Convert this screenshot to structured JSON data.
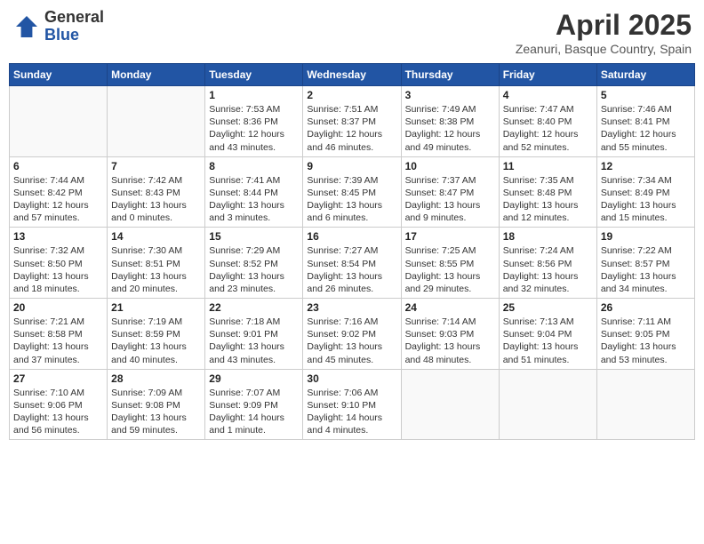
{
  "header": {
    "logo_general": "General",
    "logo_blue": "Blue",
    "month_title": "April 2025",
    "location": "Zeanuri, Basque Country, Spain"
  },
  "days_of_week": [
    "Sunday",
    "Monday",
    "Tuesday",
    "Wednesday",
    "Thursday",
    "Friday",
    "Saturday"
  ],
  "weeks": [
    [
      {
        "day": "",
        "info": ""
      },
      {
        "day": "",
        "info": ""
      },
      {
        "day": "1",
        "info": "Sunrise: 7:53 AM\nSunset: 8:36 PM\nDaylight: 12 hours and 43 minutes."
      },
      {
        "day": "2",
        "info": "Sunrise: 7:51 AM\nSunset: 8:37 PM\nDaylight: 12 hours and 46 minutes."
      },
      {
        "day": "3",
        "info": "Sunrise: 7:49 AM\nSunset: 8:38 PM\nDaylight: 12 hours and 49 minutes."
      },
      {
        "day": "4",
        "info": "Sunrise: 7:47 AM\nSunset: 8:40 PM\nDaylight: 12 hours and 52 minutes."
      },
      {
        "day": "5",
        "info": "Sunrise: 7:46 AM\nSunset: 8:41 PM\nDaylight: 12 hours and 55 minutes."
      }
    ],
    [
      {
        "day": "6",
        "info": "Sunrise: 7:44 AM\nSunset: 8:42 PM\nDaylight: 12 hours and 57 minutes."
      },
      {
        "day": "7",
        "info": "Sunrise: 7:42 AM\nSunset: 8:43 PM\nDaylight: 13 hours and 0 minutes."
      },
      {
        "day": "8",
        "info": "Sunrise: 7:41 AM\nSunset: 8:44 PM\nDaylight: 13 hours and 3 minutes."
      },
      {
        "day": "9",
        "info": "Sunrise: 7:39 AM\nSunset: 8:45 PM\nDaylight: 13 hours and 6 minutes."
      },
      {
        "day": "10",
        "info": "Sunrise: 7:37 AM\nSunset: 8:47 PM\nDaylight: 13 hours and 9 minutes."
      },
      {
        "day": "11",
        "info": "Sunrise: 7:35 AM\nSunset: 8:48 PM\nDaylight: 13 hours and 12 minutes."
      },
      {
        "day": "12",
        "info": "Sunrise: 7:34 AM\nSunset: 8:49 PM\nDaylight: 13 hours and 15 minutes."
      }
    ],
    [
      {
        "day": "13",
        "info": "Sunrise: 7:32 AM\nSunset: 8:50 PM\nDaylight: 13 hours and 18 minutes."
      },
      {
        "day": "14",
        "info": "Sunrise: 7:30 AM\nSunset: 8:51 PM\nDaylight: 13 hours and 20 minutes."
      },
      {
        "day": "15",
        "info": "Sunrise: 7:29 AM\nSunset: 8:52 PM\nDaylight: 13 hours and 23 minutes."
      },
      {
        "day": "16",
        "info": "Sunrise: 7:27 AM\nSunset: 8:54 PM\nDaylight: 13 hours and 26 minutes."
      },
      {
        "day": "17",
        "info": "Sunrise: 7:25 AM\nSunset: 8:55 PM\nDaylight: 13 hours and 29 minutes."
      },
      {
        "day": "18",
        "info": "Sunrise: 7:24 AM\nSunset: 8:56 PM\nDaylight: 13 hours and 32 minutes."
      },
      {
        "day": "19",
        "info": "Sunrise: 7:22 AM\nSunset: 8:57 PM\nDaylight: 13 hours and 34 minutes."
      }
    ],
    [
      {
        "day": "20",
        "info": "Sunrise: 7:21 AM\nSunset: 8:58 PM\nDaylight: 13 hours and 37 minutes."
      },
      {
        "day": "21",
        "info": "Sunrise: 7:19 AM\nSunset: 8:59 PM\nDaylight: 13 hours and 40 minutes."
      },
      {
        "day": "22",
        "info": "Sunrise: 7:18 AM\nSunset: 9:01 PM\nDaylight: 13 hours and 43 minutes."
      },
      {
        "day": "23",
        "info": "Sunrise: 7:16 AM\nSunset: 9:02 PM\nDaylight: 13 hours and 45 minutes."
      },
      {
        "day": "24",
        "info": "Sunrise: 7:14 AM\nSunset: 9:03 PM\nDaylight: 13 hours and 48 minutes."
      },
      {
        "day": "25",
        "info": "Sunrise: 7:13 AM\nSunset: 9:04 PM\nDaylight: 13 hours and 51 minutes."
      },
      {
        "day": "26",
        "info": "Sunrise: 7:11 AM\nSunset: 9:05 PM\nDaylight: 13 hours and 53 minutes."
      }
    ],
    [
      {
        "day": "27",
        "info": "Sunrise: 7:10 AM\nSunset: 9:06 PM\nDaylight: 13 hours and 56 minutes."
      },
      {
        "day": "28",
        "info": "Sunrise: 7:09 AM\nSunset: 9:08 PM\nDaylight: 13 hours and 59 minutes."
      },
      {
        "day": "29",
        "info": "Sunrise: 7:07 AM\nSunset: 9:09 PM\nDaylight: 14 hours and 1 minute."
      },
      {
        "day": "30",
        "info": "Sunrise: 7:06 AM\nSunset: 9:10 PM\nDaylight: 14 hours and 4 minutes."
      },
      {
        "day": "",
        "info": ""
      },
      {
        "day": "",
        "info": ""
      },
      {
        "day": "",
        "info": ""
      }
    ]
  ]
}
